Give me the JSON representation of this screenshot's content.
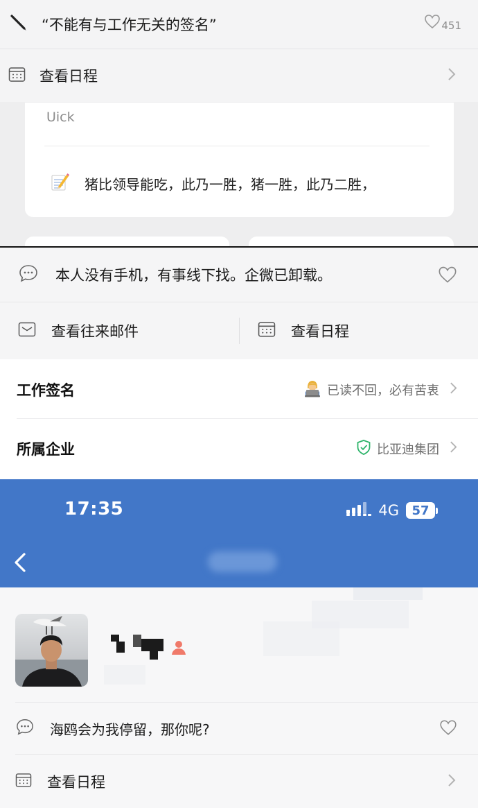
{
  "screen1": {
    "signature": {
      "text": "“不能有与工作无关的签名”",
      "like_count": "451",
      "edit_icon": "pencil-icon",
      "like_icon": "heart-outline-icon"
    },
    "schedule": {
      "label": "查看日程",
      "icon": "calendar-icon"
    },
    "card": {
      "author": "Uick",
      "note_icon": "memo-emoji-icon",
      "note_text": "猪比领导能吃，此乃一胜，猪一胜，此乃二胜，"
    }
  },
  "screen2": {
    "signature": {
      "text": "本人没有手机，有事线下找。企微已卸载。",
      "icon": "chat-bubble-icon",
      "like_icon": "heart-outline-icon"
    },
    "actions": [
      {
        "label": "查看往来邮件",
        "icon": "mail-icon"
      },
      {
        "label": "查看日程",
        "icon": "calendar-icon"
      }
    ],
    "work_signature": {
      "label": "工作签名",
      "value": "已读不回，必有苦衷",
      "value_icon": "technologist-emoji-icon"
    },
    "company": {
      "label": "所属企业",
      "value": "比亚迪集团",
      "value_icon": "shield-check-icon",
      "brand_color": "#2db46a"
    }
  },
  "screen3": {
    "status_bar": {
      "time": "17:35",
      "network": "4G",
      "battery": "57"
    },
    "header_color": "#4277c8",
    "signature": {
      "text": "海鸥会为我停留，那你呢?",
      "icon": "chat-bubble-icon",
      "like_icon": "heart-outline-icon"
    },
    "schedule": {
      "label": "查看日程",
      "icon": "calendar-icon"
    }
  }
}
